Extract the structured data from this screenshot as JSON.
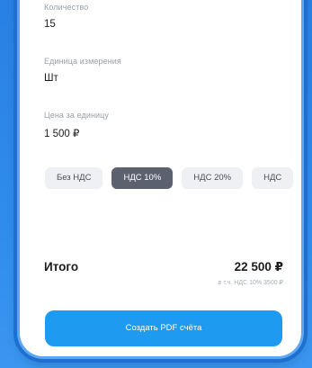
{
  "form": {
    "quantity_label": "Количество",
    "quantity_value": "15",
    "unit_label": "Единица измерения",
    "unit_value": "Шт",
    "price_label": "Цена за единицу",
    "price_value": "1 500 ₽"
  },
  "vat_options": [
    {
      "label": "Без НДС",
      "selected": false
    },
    {
      "label": "НДС 10%",
      "selected": true
    },
    {
      "label": "НДС 20%",
      "selected": false
    },
    {
      "label": "НДС",
      "selected": false
    }
  ],
  "summary": {
    "total_label": "Итого",
    "total_value": "22 500 ₽",
    "vat_note": "в т.ч. НДС 10% 3500 ₽"
  },
  "actions": {
    "create_pdf_label": "Создать PDF счёта"
  },
  "colors": {
    "background": "#2f86e6",
    "accent_button": "#1e9bf0",
    "chip_selected": "#5c6170",
    "chip_default": "#eef0f3"
  }
}
